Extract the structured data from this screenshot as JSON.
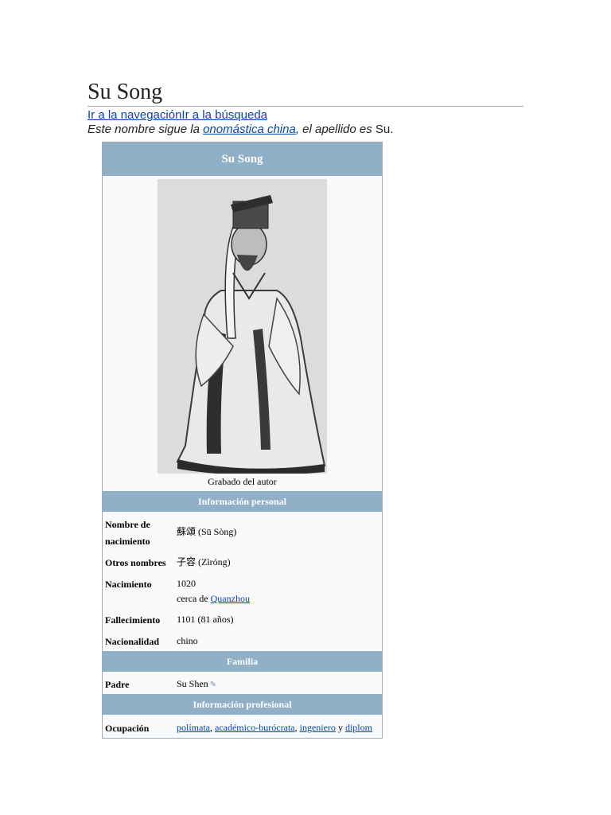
{
  "page": {
    "title": "Su Song",
    "jump_nav": "Ir a la navegación",
    "jump_search": "Ir a la búsqueda",
    "hatnote": {
      "prefix": "Este nombre sigue la",
      "link": "onomástica china",
      "middle": ", el apellido es",
      "surname": "Su."
    }
  },
  "infobox": {
    "title": "Su Song",
    "image_caption": "Grabado del autor",
    "sections": {
      "personal": "Información personal",
      "family": "Familia",
      "professional": "Información profesional"
    },
    "rows": {
      "birth_name": {
        "label": "Nombre de nacimiento",
        "value": "蘇頌 (Sū Sòng)"
      },
      "other_names": {
        "label": "Otros nombres",
        "value": "子容 (Zìróng)"
      },
      "birth": {
        "label": "Nacimiento",
        "year": "1020",
        "place_prefix": "cerca de",
        "place_link": "Quanzhou"
      },
      "death": {
        "label": "Fallecimiento",
        "value": "1101 (81 años)"
      },
      "nationality": {
        "label": "Nacionalidad",
        "value": "chino"
      },
      "father": {
        "label": "Padre",
        "value": "Su Shen"
      },
      "occupation": {
        "label": "Ocupación",
        "links": [
          "polímata",
          "académico-burócrata",
          "ingeniero",
          "diplom"
        ],
        "sep1": ", ",
        "sep2": ", ",
        "sep3": " y "
      }
    }
  },
  "colors": {
    "section_header": "#8fb0c7",
    "link": "#0645ad",
    "infobox_bg": "#f8f9fa"
  }
}
